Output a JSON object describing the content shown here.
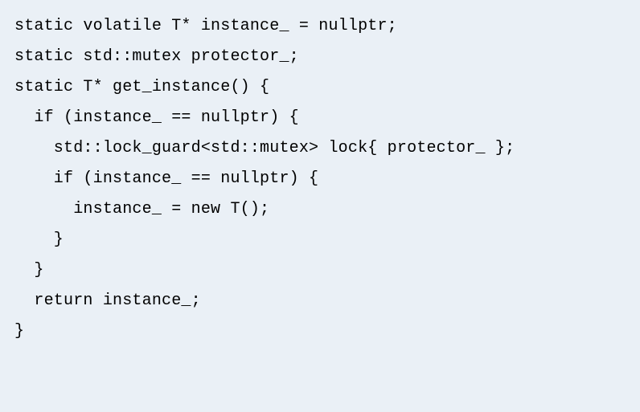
{
  "code": {
    "lines": [
      "static volatile T* instance_ = nullptr;",
      "static std::mutex protector_;",
      "",
      "static T* get_instance() {",
      "  if (instance_ == nullptr) {",
      "    std::lock_guard<std::mutex> lock{ protector_ };",
      "    if (instance_ == nullptr) {",
      "      instance_ = new T();",
      "    }",
      "  }",
      "  return instance_;",
      "}"
    ]
  }
}
